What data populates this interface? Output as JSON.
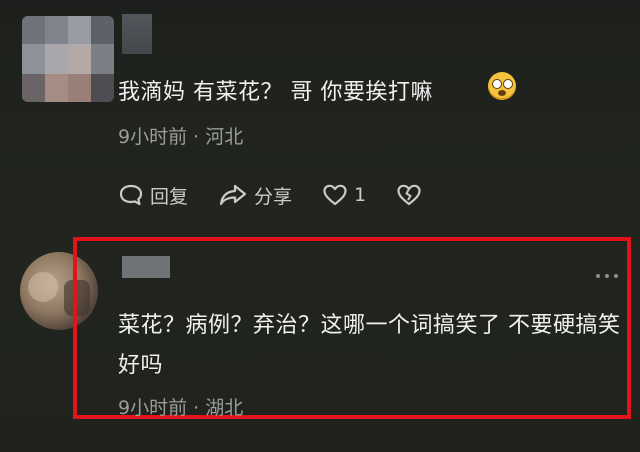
{
  "comments": [
    {
      "text": "我滴妈 有菜花？ 哥 你要挨打嘛",
      "emoji": "astonished-face-emoji",
      "meta": "9小时前 · 河北",
      "actions": {
        "reply_label": "回复",
        "share_label": "分享",
        "like_count": "1"
      }
    },
    {
      "text": "菜花？病例？弃治？这哪一个词搞笑了 不要硬搞笑好吗",
      "meta": "9小时前 · 湖北",
      "more_icon": "more-dots-icon"
    }
  ],
  "highlight_color": "#e0141a",
  "background_color": "#20231f"
}
